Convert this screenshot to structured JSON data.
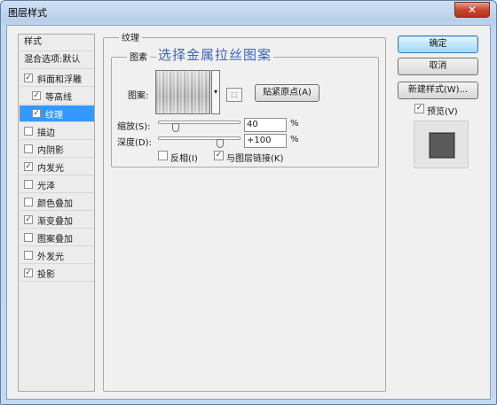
{
  "window": {
    "title": "图层样式",
    "close_glyph": "✕"
  },
  "left_list": {
    "items": [
      {
        "label": "样式",
        "type": "header"
      },
      {
        "label": "混合选项:默认",
        "type": "header"
      },
      {
        "label": "斜面和浮雕",
        "checked": true,
        "selected": false,
        "indent": false
      },
      {
        "label": "等高线",
        "checked": true,
        "selected": false,
        "indent": true
      },
      {
        "label": "纹理",
        "checked": true,
        "selected": true,
        "indent": true
      },
      {
        "label": "描边",
        "checked": false,
        "selected": false,
        "indent": false
      },
      {
        "label": "内阴影",
        "checked": false,
        "selected": false,
        "indent": false
      },
      {
        "label": "内发光",
        "checked": true,
        "selected": false,
        "indent": false
      },
      {
        "label": "光泽",
        "checked": false,
        "selected": false,
        "indent": false
      },
      {
        "label": "颜色叠加",
        "checked": false,
        "selected": false,
        "indent": false
      },
      {
        "label": "渐变叠加",
        "checked": true,
        "selected": false,
        "indent": false
      },
      {
        "label": "图案叠加",
        "checked": false,
        "selected": false,
        "indent": false
      },
      {
        "label": "外发光",
        "checked": false,
        "selected": false,
        "indent": false
      },
      {
        "label": "投影",
        "checked": true,
        "selected": false,
        "indent": false
      }
    ]
  },
  "texture_panel": {
    "group_title": "纹理",
    "sub_group_title": "图素",
    "annotation": "选择金属拉丝图案",
    "pattern_label": "图案:",
    "snap_origin_button": "贴紧原点(A)",
    "scale_label": "缩放(S):",
    "scale_value": "40",
    "scale_level": 0.22,
    "depth_label": "深度(D):",
    "depth_value": "+100",
    "depth_level": 0.75,
    "percent": "%",
    "invert_label": "反相(I)",
    "invert_checked": false,
    "link_label": "与图层链接(K)",
    "link_checked": true
  },
  "right_buttons": {
    "ok": "确定",
    "cancel": "取消",
    "new_style": "新建样式(W)...",
    "preview_label": "预览(V)",
    "preview_checked": true
  },
  "icons": {
    "close": "close-icon",
    "dropdown": "dropdown-arrow-icon",
    "new_preset": "new-preset-icon",
    "check": "checkmark-icon"
  },
  "colors": {
    "selection": "#3399ff",
    "annotation": "#3f63b5",
    "preview": "#5a5a5a"
  }
}
